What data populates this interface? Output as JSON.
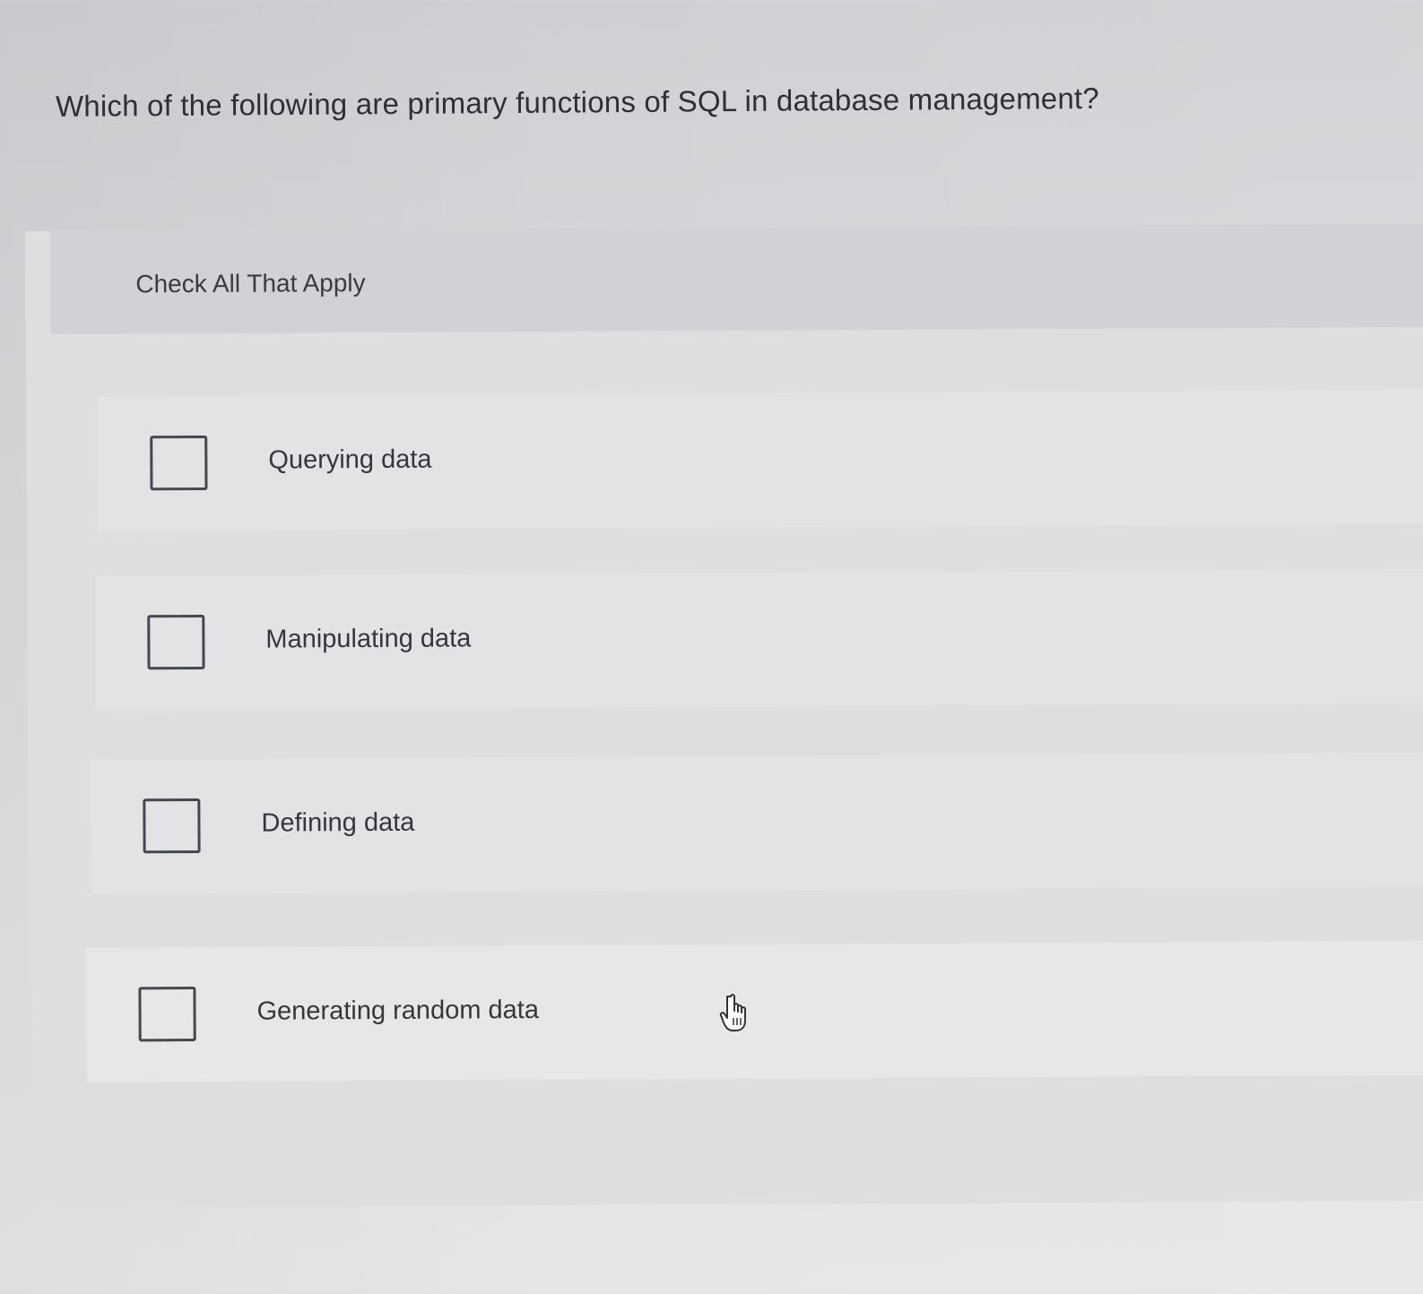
{
  "question": {
    "text": "Which of the following are primary functions of SQL in database management?"
  },
  "panel": {
    "instruction": "Check All That Apply",
    "options": [
      {
        "label": "Querying data",
        "checked": false
      },
      {
        "label": "Manipulating data",
        "checked": false
      },
      {
        "label": "Defining data",
        "checked": false
      },
      {
        "label": "Generating random data",
        "checked": false
      }
    ]
  },
  "cursor": {
    "icon": "pointing-hand-icon"
  },
  "colors": {
    "text": "#2f3033",
    "checkbox_border": "#45484f",
    "panel_bg": "#dcdedf",
    "header_bg": "#d0d2d5"
  }
}
